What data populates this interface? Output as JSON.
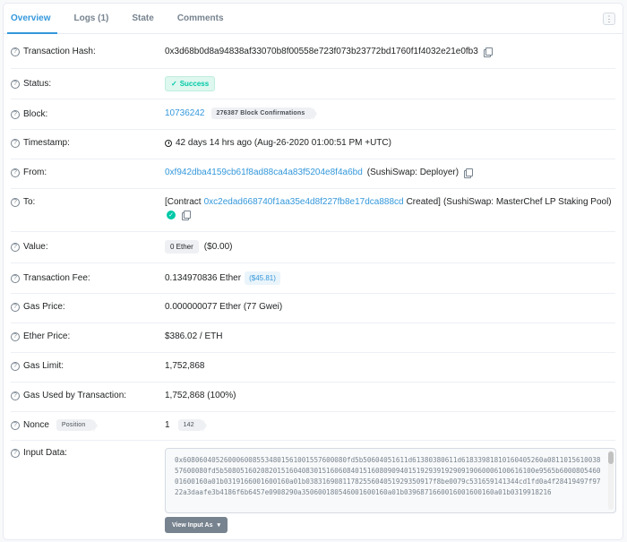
{
  "tabs": [
    {
      "label": "Overview",
      "active": true
    },
    {
      "label": "Logs (1)"
    },
    {
      "label": "State"
    },
    {
      "label": "Comments"
    }
  ],
  "kebab_icon": "⋮",
  "rows": {
    "hash": {
      "label": "Transaction Hash:",
      "value": "0x3d68b0d8a94838af33070b8f00558e723f073b23772bd1760f1f4032e21e0fb3"
    },
    "status": {
      "label": "Status:",
      "value": "Success"
    },
    "block": {
      "label": "Block:",
      "value": "10736242",
      "confirmations": "276387 Block Confirmations"
    },
    "timestamp": {
      "label": "Timestamp:",
      "value": "42 days 14 hrs ago (Aug-26-2020 01:00:51 PM +UTC)"
    },
    "from": {
      "label": "From:",
      "address": "0xf942dba4159cb61f8ad88ca4a83f5204e8f4a6bd",
      "name": "(SushiSwap: Deployer)"
    },
    "to": {
      "label": "To:",
      "prefix": "[Contract",
      "address": "0xc2edad668740f1aa35e4d8f227fb8e17dca888cd",
      "created": "Created]",
      "name": "(SushiSwap: MasterChef LP Staking Pool)"
    },
    "value": {
      "label": "Value:",
      "amount": "0 Ether",
      "usd": "($0.00)"
    },
    "fee": {
      "label": "Transaction Fee:",
      "amount": "0.134970836 Ether",
      "usd": "($45.81)"
    },
    "gas_price": {
      "label": "Gas Price:",
      "value": "0.000000077 Ether (77 Gwei)"
    },
    "ether_price": {
      "label": "Ether Price:",
      "value": "$386.02 / ETH"
    },
    "gas_limit": {
      "label": "Gas Limit:",
      "value": "1,752,868"
    },
    "gas_used": {
      "label": "Gas Used by Transaction:",
      "value": "1,752,868 (100%)"
    },
    "nonce": {
      "label": "Nonce",
      "position_label": "Position",
      "value": "1",
      "position": "142"
    },
    "input": {
      "label": "Input Data:",
      "data": "0x608060405260006008553480156100155760008​0fd5b50604051611d61380380611d6183398181016040526​0a08110156100385760008​0fd5b508051602082015160408301516060840151608090940151929391929091906000610061610​0e9565b600080546001600160a01b0319166001600160a01b03831690811782556040519293509​17f8be0079c531659141344cd1fd0a4f28419497f9722a3daafe3b4186f6b6457e0908290a350600180546001600160a01b0396871660016001600160a01b0319918216",
      "button": "View Input As"
    }
  }
}
